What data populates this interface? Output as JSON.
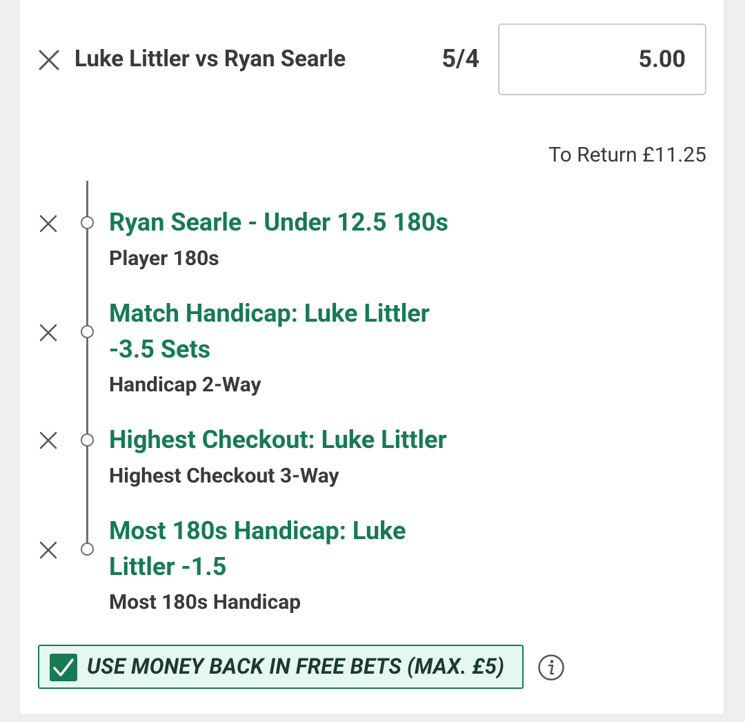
{
  "bet": {
    "event": "Luke Littler vs Ryan Searle",
    "odds": "5/4",
    "stake": "5.00",
    "to_return": "To Return £11.25"
  },
  "legs": [
    {
      "selection_line1": "Ryan Searle - Under 12.5 180s",
      "selection_line2": "",
      "market": "Player 180s"
    },
    {
      "selection_line1": "Match Handicap: Luke Littler",
      "selection_line2": "-3.5 Sets",
      "market": "Handicap 2-Way"
    },
    {
      "selection_line1": "Highest Checkout: Luke Littler",
      "selection_line2": "",
      "market": "Highest Checkout 3-Way"
    },
    {
      "selection_line1": "Most 180s Handicap: Luke",
      "selection_line2": "Littler -1.5",
      "market": "Most 180s Handicap"
    }
  ],
  "money_back": {
    "label": "USE MONEY BACK IN FREE BETS (MAX. £5)",
    "checked": true
  },
  "icons": {
    "remove": "close-icon",
    "check": "checkmark-icon",
    "info": "info-icon"
  },
  "colors": {
    "accent_green": "#177a55",
    "text_dark": "#3a3a3a",
    "money_back_bg": "#e6f7f1"
  }
}
